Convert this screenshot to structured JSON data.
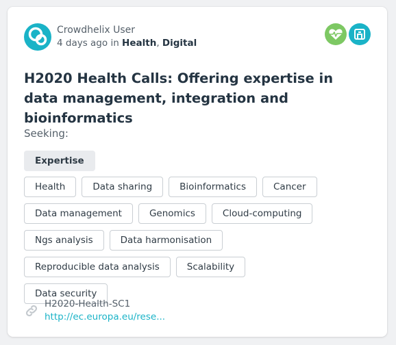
{
  "post": {
    "author": "Crowdhelix User",
    "time": "4 days ago",
    "in_word": "in",
    "categories": [
      "Health",
      "Digital"
    ],
    "category_sep": ",",
    "category_icons": [
      {
        "name": "health-heartbeat-icon",
        "color": "#7dc863"
      },
      {
        "name": "digital-circuit-icon",
        "color": "#1ab3c7"
      }
    ],
    "title": "H2020 Health Calls: Offering expertise in data management, integration and bioinformatics",
    "seeking_label": "Seeking:",
    "seeking": "Expertise",
    "tags": [
      "Health",
      "Data sharing",
      "Bioinformatics",
      "Cancer",
      "Data management",
      "Genomics",
      "Cloud-computing",
      "Ngs analysis",
      "Data harmonisation",
      "Reproducible data analysis",
      "Scalability",
      "Data security"
    ],
    "link": {
      "icon": "link-icon",
      "title": "H2020-Health-SC1",
      "url": "http://ec.europa.eu/rese..."
    }
  }
}
